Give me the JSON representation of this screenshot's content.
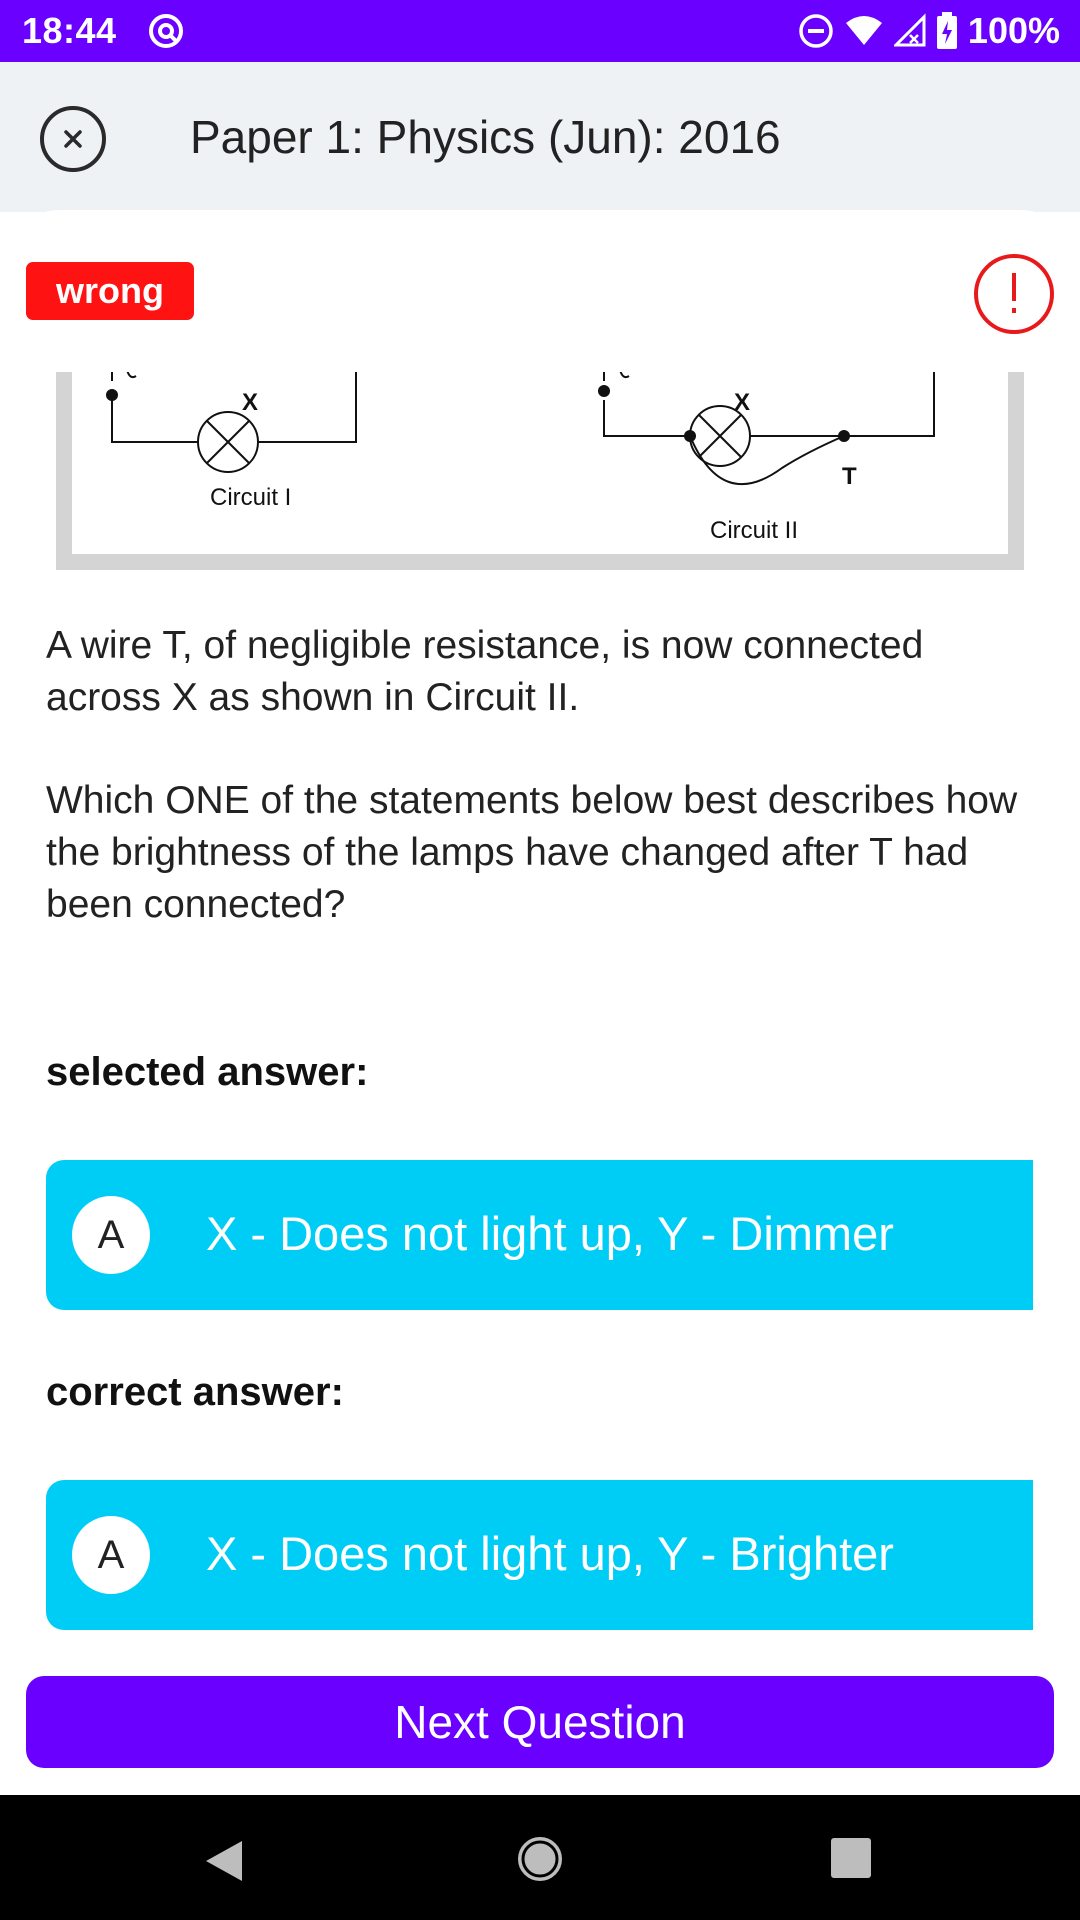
{
  "status_bar": {
    "time": "18:44",
    "battery": "100%",
    "icons": [
      "app-notification-icon",
      "dnd-icon",
      "wifi-icon",
      "signal-icon",
      "battery-icon"
    ]
  },
  "header": {
    "title": "Paper 1: Physics (Jun): 2016",
    "close_icon": "close-icon"
  },
  "result": {
    "badge": "wrong",
    "report_icon": "exclamation-icon",
    "badge_color": "#ff1212"
  },
  "figure": {
    "label_x_left": "X",
    "label_x_right": "X",
    "label_t": "T",
    "caption_1": "Circuit I",
    "caption_2": "Circuit II"
  },
  "question": {
    "paragraph_1": "A wire T, of negligible resistance, is now connected across X as shown in Circuit II.",
    "paragraph_2": "Which ONE of the statements below best describes how the brightness of the lamps have changed after T had been connected?"
  },
  "selected": {
    "label": "selected answer:",
    "letter": "A",
    "text": "X - Does not light up, Y - Dimmer"
  },
  "correct": {
    "label": "correct answer:",
    "letter": "A",
    "text": "X - Does not light up, Y - Brighter"
  },
  "next_button": "Next Question",
  "colors": {
    "primary": "#6a00ff",
    "answer_bg": "#00cdf5",
    "error": "#ff1212"
  }
}
